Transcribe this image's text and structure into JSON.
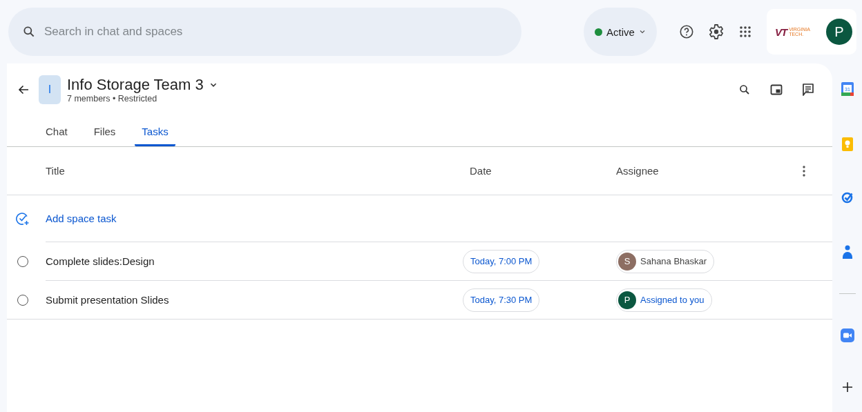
{
  "search": {
    "placeholder": "Search in chat and spaces"
  },
  "status": {
    "label": "Active",
    "color": "#1e8e3e"
  },
  "account": {
    "logo_mark": "VT",
    "logo_line1": "VIRGINIA",
    "logo_line2": "TECH.",
    "avatar_initial": "P"
  },
  "space": {
    "avatar_initial": "I",
    "title": "Info Storage Team 3",
    "subtitle": "7 members • Restricted"
  },
  "tabs": [
    {
      "label": "Chat",
      "selected": false
    },
    {
      "label": "Files",
      "selected": false
    },
    {
      "label": "Tasks",
      "selected": true
    }
  ],
  "table": {
    "columns": [
      "Title",
      "Date",
      "Assignee"
    ],
    "add_label": "Add space task",
    "rows": [
      {
        "title": "Complete slides:Design",
        "checked": false,
        "date": "Today, 7:00 PM",
        "assignee": {
          "initial": "S",
          "name": "Sahana Bhaskar",
          "color": "#8d6e63",
          "kind": "member"
        }
      },
      {
        "title": "Submit presentation Slides",
        "checked": false,
        "date": "Today, 7:30 PM",
        "assignee": {
          "initial": "P",
          "name": "Assigned to you",
          "color": "#0b5740",
          "kind": "self"
        }
      }
    ]
  },
  "side_panel": {
    "calendar_day": "31"
  }
}
